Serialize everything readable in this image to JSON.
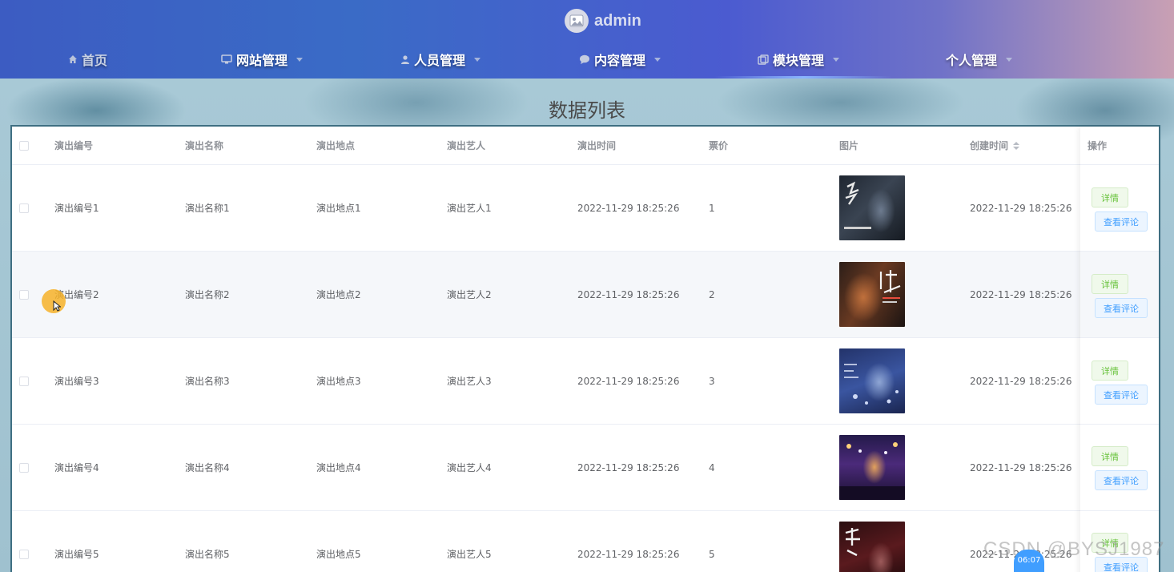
{
  "header": {
    "brand": "admin",
    "nav": [
      {
        "label": "首页",
        "icon": "home-icon",
        "has_dropdown": false
      },
      {
        "label": "网站管理",
        "icon": "monitor-icon",
        "has_dropdown": true
      },
      {
        "label": "人员管理",
        "icon": "user-icon",
        "has_dropdown": true
      },
      {
        "label": "内容管理",
        "icon": "message-icon",
        "has_dropdown": true
      },
      {
        "label": "模块管理",
        "icon": "copy-icon",
        "has_dropdown": true
      },
      {
        "label": "个人管理",
        "icon": "",
        "has_dropdown": true
      }
    ],
    "active_nav_index": 4
  },
  "page_title": "数据列表",
  "table": {
    "columns": [
      "演出编号",
      "演出名称",
      "演出地点",
      "演出艺人",
      "演出时间",
      "票价",
      "图片",
      "创建时间",
      "操作"
    ],
    "rows": [
      {
        "code": "演出编号1",
        "name": "演出名称1",
        "venue": "演出地点1",
        "artist": "演出艺人1",
        "time": "2022-11-29 18:25:26",
        "price": "1",
        "created": "2022-11-29 18:25:26"
      },
      {
        "code": "演出编号2",
        "name": "演出名称2",
        "venue": "演出地点2",
        "artist": "演出艺人2",
        "time": "2022-11-29 18:25:26",
        "price": "2",
        "created": "2022-11-29 18:25:26"
      },
      {
        "code": "演出编号3",
        "name": "演出名称3",
        "venue": "演出地点3",
        "artist": "演出艺人3",
        "time": "2022-11-29 18:25:26",
        "price": "3",
        "created": "2022-11-29 18:25:26"
      },
      {
        "code": "演出编号4",
        "name": "演出名称4",
        "venue": "演出地点4",
        "artist": "演出艺人4",
        "time": "2022-11-29 18:25:26",
        "price": "4",
        "created": "2022-11-29 18:25:26"
      },
      {
        "code": "演出编号5",
        "name": "演出名称5",
        "venue": "演出地点5",
        "artist": "演出艺人5",
        "time": "2022-11-29 18:25:26",
        "price": "5",
        "created": "2022-11-29 18:25:26"
      }
    ],
    "actions": {
      "detail": "详情",
      "comment": "查看评论"
    }
  },
  "overlay": {
    "watermark": "CSDN @BYSJ1987",
    "timestamp": "06:07"
  },
  "colors": {
    "header_start": "#3c5cc2",
    "header_end": "#c9a0b4",
    "detail_button": "#67c23a",
    "comment_button": "#409eff",
    "table_border": "#3f6f82"
  }
}
